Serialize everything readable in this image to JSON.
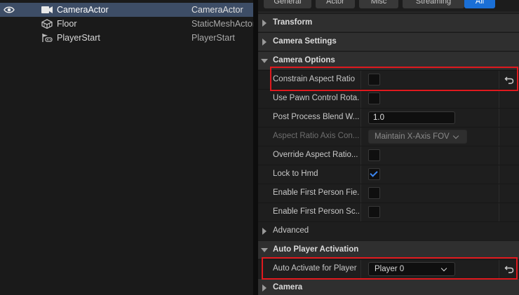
{
  "outliner": {
    "rows": [
      {
        "name": "CameraActor",
        "type": "CameraActor",
        "icon": "camera-icon",
        "selected": true
      },
      {
        "name": "Floor",
        "type": "StaticMeshActor",
        "icon": "static-mesh-icon",
        "selected": false
      },
      {
        "name": "PlayerStart",
        "type": "PlayerStart",
        "icon": "player-start-icon",
        "selected": false
      }
    ]
  },
  "details": {
    "tabs": [
      {
        "label": "General",
        "active": false
      },
      {
        "label": "Actor",
        "active": false
      },
      {
        "label": "Misc",
        "active": false
      },
      {
        "label": "Streaming",
        "active": false
      },
      {
        "label": "All",
        "active": true
      }
    ],
    "categories": {
      "transform": "Transform",
      "camera_settings": "Camera Settings",
      "camera_options": "Camera Options",
      "advanced": "Advanced",
      "auto_player_activation": "Auto Player Activation",
      "camera": "Camera"
    },
    "camera_options": {
      "constrain_aspect_ratio": {
        "label": "Constrain Aspect Ratio",
        "checked": false
      },
      "use_pawn_control_rotation": {
        "label": "Use Pawn Control Rota...",
        "checked": false
      },
      "post_process_blend_weight": {
        "label": "Post Process Blend W...",
        "value": "1.0"
      },
      "aspect_ratio_axis_constraint": {
        "label": "Aspect Ratio Axis Con...",
        "value": "Maintain X-Axis FOV"
      },
      "override_aspect_ratio": {
        "label": "Override Aspect Ratio...",
        "checked": false
      },
      "lock_to_hmd": {
        "label": "Lock to Hmd",
        "checked": true
      },
      "enable_first_person_field": {
        "label": "Enable First Person Fie...",
        "checked": false
      },
      "enable_first_person_scale": {
        "label": "Enable First Person Sc...",
        "checked": false
      }
    },
    "auto_player_activation": {
      "auto_activate_for_player": {
        "label": "Auto Activate for Player",
        "value": "Player 0"
      }
    }
  },
  "colors": {
    "selection": "#3d4d66",
    "accent": "#1a6fd6",
    "highlight": "#e0191e",
    "checkmark": "#3b86f0"
  }
}
